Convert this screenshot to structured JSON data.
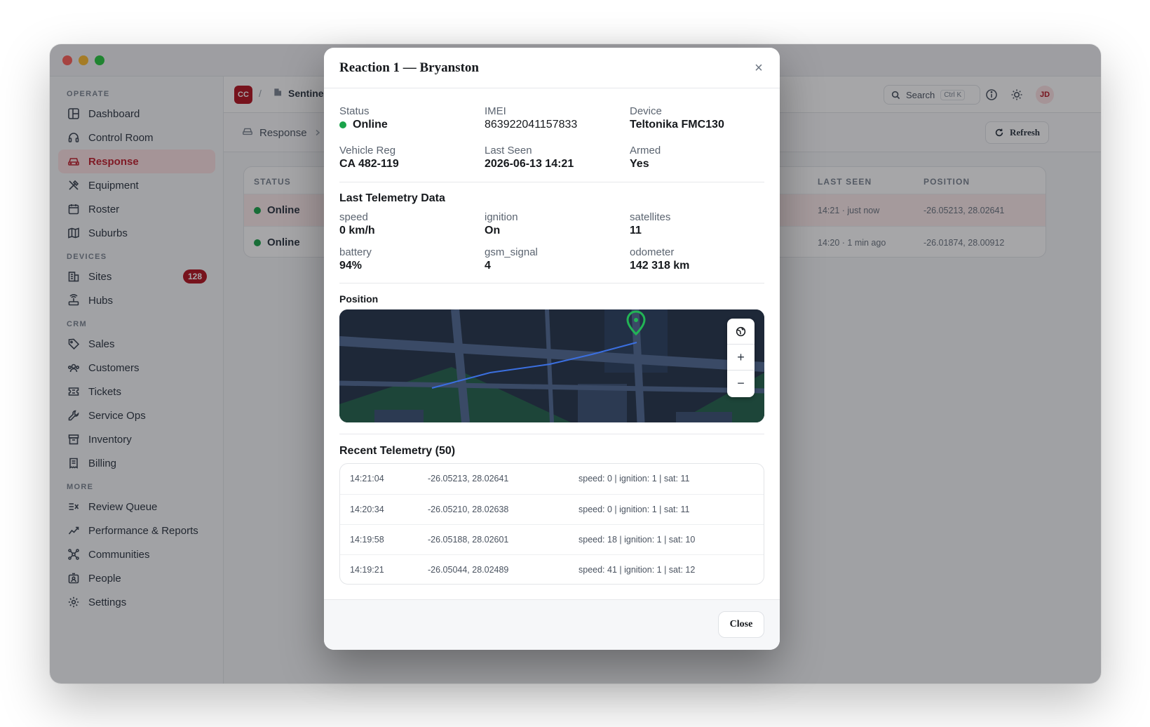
{
  "sidebar": {
    "sections": [
      {
        "label": "OPERATE"
      },
      {
        "label": "DEVICES"
      },
      {
        "label": "CRM"
      },
      {
        "label": "MORE"
      }
    ],
    "items": [
      {
        "label": "Dashboard",
        "icon": "dashboard-icon"
      },
      {
        "label": "Control Room",
        "icon": "headset-icon"
      },
      {
        "label": "Response",
        "icon": "car-icon",
        "active": true
      },
      {
        "label": "Equipment",
        "icon": "tools-icon"
      },
      {
        "label": "Roster",
        "icon": "calendar-icon"
      },
      {
        "label": "Suburbs",
        "icon": "map-icon"
      },
      {
        "label": "Sites",
        "icon": "building-icon",
        "badge": "128"
      },
      {
        "label": "Hubs",
        "icon": "router-icon"
      },
      {
        "label": "Sales",
        "icon": "tag-icon"
      },
      {
        "label": "Customers",
        "icon": "users-icon"
      },
      {
        "label": "Tickets",
        "icon": "ticket-icon"
      },
      {
        "label": "Service Ops",
        "icon": "wrench-icon"
      },
      {
        "label": "Inventory",
        "icon": "archive-icon"
      },
      {
        "label": "Billing",
        "icon": "receipt-icon"
      },
      {
        "label": "Review Queue",
        "icon": "list-check-icon"
      },
      {
        "label": "Performance & Reports",
        "icon": "chart-line-icon"
      },
      {
        "label": "Communities",
        "icon": "network-icon"
      },
      {
        "label": "People",
        "icon": "id-badge-icon"
      },
      {
        "label": "Settings",
        "icon": "gear-icon"
      }
    ]
  },
  "topbar": {
    "org_badge": "CC",
    "separator": "/",
    "org_name": "Sentinel G",
    "search_label": "Search",
    "search_shortcut": "Ctrl K",
    "avatar_initials": "JD"
  },
  "subbar": {
    "crumb": "Response",
    "refresh_label": "Refresh"
  },
  "table": {
    "headers": {
      "status": "STATUS",
      "last_seen": "LAST SEEN",
      "position": "POSITION"
    },
    "rows": [
      {
        "status": "Online",
        "last_seen": "14:21 · just now",
        "position": "-26.05213, 28.02641"
      },
      {
        "status": "Online",
        "last_seen": "14:20 · 1 min ago",
        "position": "-26.01874, 28.00912"
      }
    ]
  },
  "modal": {
    "title": "Reaction 1 — Bryanston",
    "close_x": "×",
    "fields": {
      "status": {
        "label": "Status",
        "value": "Online"
      },
      "imei": {
        "label": "IMEI",
        "value": "863922041157833"
      },
      "device": {
        "label": "Device",
        "value": "Teltonika FMC130"
      },
      "vehicle_reg": {
        "label": "Vehicle Reg",
        "value": "CA 482-119"
      },
      "last_seen": {
        "label": "Last Seen",
        "value": "2026-06-13 14:21"
      },
      "armed": {
        "label": "Armed",
        "value": "Yes"
      }
    },
    "telemetry_title": "Last Telemetry Data",
    "telemetry": {
      "speed": {
        "label": "speed",
        "value": "0 km/h"
      },
      "ignition": {
        "label": "ignition",
        "value": "On"
      },
      "satellites": {
        "label": "satellites",
        "value": "11"
      },
      "battery": {
        "label": "battery",
        "value": "94%"
      },
      "gsm_signal": {
        "label": "gsm_signal",
        "value": "4"
      },
      "odometer": {
        "label": "odometer",
        "value": "142 318 km"
      }
    },
    "position_title": "Position",
    "map_controls": {
      "globe": "globe-icon",
      "zoom_in": "+",
      "zoom_out": "−"
    },
    "recent_title": "Recent Telemetry (50)",
    "recent": [
      {
        "time": "14:21:04",
        "coords": "-26.05213, 28.02641",
        "info": "speed: 0 | ignition: 1 | sat: 11"
      },
      {
        "time": "14:20:34",
        "coords": "-26.05210, 28.02638",
        "info": "speed: 0 | ignition: 1 | sat: 11"
      },
      {
        "time": "14:19:58",
        "coords": "-26.05188, 28.02601",
        "info": "speed: 18 | ignition: 1 | sat: 10"
      },
      {
        "time": "14:19:21",
        "coords": "-26.05044, 28.02489",
        "info": "speed: 41 | ignition: 1 | sat: 12"
      }
    ],
    "close_label": "Close"
  },
  "colors": {
    "brand": "#b4121f",
    "online": "#1aa34a",
    "map_bg": "#1e2838",
    "route": "#3b6fe0",
    "marker": "#22b455"
  }
}
